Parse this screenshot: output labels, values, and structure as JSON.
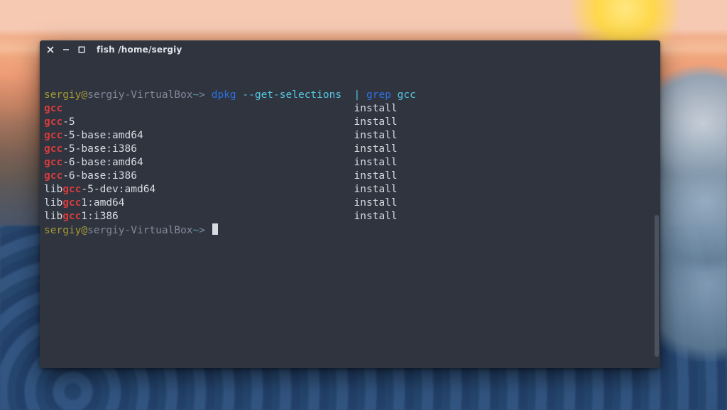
{
  "window": {
    "title": "fish  /home/sergiy"
  },
  "prompt": {
    "user": "sergiy",
    "at": "@",
    "host": "sergiy-VirtualBox",
    "sep": "~",
    "arrow": ">"
  },
  "cmd": {
    "bin": "dpkg",
    "opt": "--get-selections",
    "pipe": "|",
    "bin2": "grep",
    "arg": "gcc"
  },
  "status": "install",
  "rows": [
    {
      "pre": "",
      "match": "gcc",
      "post": ""
    },
    {
      "pre": "",
      "match": "gcc",
      "post": "-5"
    },
    {
      "pre": "",
      "match": "gcc",
      "post": "-5-base:amd64"
    },
    {
      "pre": "",
      "match": "gcc",
      "post": "-5-base:i386"
    },
    {
      "pre": "",
      "match": "gcc",
      "post": "-6-base:amd64"
    },
    {
      "pre": "",
      "match": "gcc",
      "post": "-6-base:i386"
    },
    {
      "pre": "lib",
      "match": "gcc",
      "post": "-5-dev:amd64"
    },
    {
      "pre": "lib",
      "match": "gcc",
      "post": "1:amd64"
    },
    {
      "pre": "lib",
      "match": "gcc",
      "post": "1:i386"
    }
  ],
  "layout": {
    "status_col": 50
  }
}
